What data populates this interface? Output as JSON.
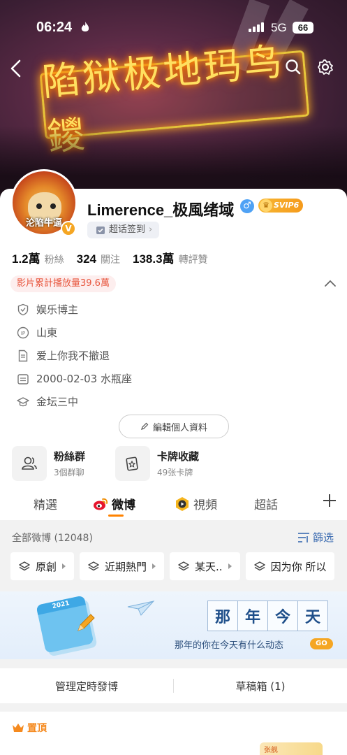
{
  "status_bar": {
    "time": "06:24",
    "network": "5G",
    "battery": "66"
  },
  "banner": {
    "neon_text": "陷狱极地玛鸟鑁"
  },
  "profile": {
    "avatar_caption": "沦陷牛逼",
    "username": "Limerence_极風绪域",
    "gender_symbol": "♂",
    "svip_label": "SVIP6",
    "checkin_label": "超话签到",
    "stats": [
      {
        "num": "1.2萬",
        "label": "粉絲"
      },
      {
        "num": "324",
        "label": "關注"
      },
      {
        "num": "138.3萬",
        "label": "轉評贊"
      }
    ],
    "play_count": "影片累計播放量39.6萬",
    "info": [
      {
        "icon": "shield-icon",
        "text": "娱乐博主"
      },
      {
        "icon": "ip-location-icon",
        "text": "山東"
      },
      {
        "icon": "document-icon",
        "text": "爱上你我不撤退"
      },
      {
        "icon": "calendar-icon",
        "text": "2000-02-03 水瓶座"
      },
      {
        "icon": "graduation-cap-icon",
        "text": "金坛三中"
      }
    ],
    "edit_label": "編輯個人資料"
  },
  "tiles": [
    {
      "icon": "fan-group-icon",
      "title": "粉絲群",
      "sub": "3個群聊"
    },
    {
      "icon": "card-collection-icon",
      "title": "卡牌收藏",
      "sub": "49张卡牌"
    }
  ],
  "tabs": [
    {
      "label": "精選"
    },
    {
      "label": "微博"
    },
    {
      "label": "視頻"
    },
    {
      "label": "超話"
    }
  ],
  "feed": {
    "all_label": "全部微博 (12048)",
    "filter_label": "篩选",
    "chips": [
      "原創",
      "近期熱門",
      "某天..",
      "因为你 所以"
    ]
  },
  "promo": {
    "calendar_year": "2021",
    "chars": [
      "那",
      "年",
      "今",
      "天"
    ],
    "subtitle": "那年的你在今天有什么动态",
    "go": "GO"
  },
  "manage": {
    "scheduled": "管理定時發博",
    "drafts": "草稿箱 (1)"
  },
  "pinned": {
    "label": "置頂",
    "thumb_text": "张舰"
  },
  "colors": {
    "accent_orange": "#ff8200",
    "link_blue": "#3a6ab0",
    "play_count_red": "#e8573f"
  }
}
